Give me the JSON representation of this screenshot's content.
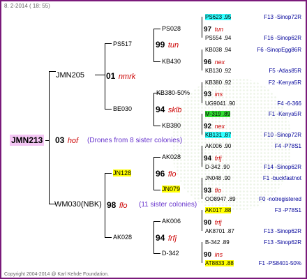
{
  "header": "8.  2-2014 ( 18: 55)",
  "footer": "Copyright 2004-2014 @ Karl Kehde Foundation.",
  "root": {
    "name": "JMN213",
    "gen_num": "03",
    "gen_code": "hof",
    "note": "(Drones from 8 sister colonies)"
  },
  "mid_note": "(11 sister colonies)",
  "nodes": {
    "JMN205": {
      "name": "JMN205"
    },
    "JMN205_g": {
      "num": "01",
      "code": "nmrk"
    },
    "WM030": {
      "name": "WM030(NBK)"
    },
    "WM030_g": {
      "num": "98",
      "code": "flo"
    },
    "PS517": {
      "name": "PS517"
    },
    "PS517_g": {
      "num": "99",
      "code": "tun"
    },
    "BE030": {
      "name": "BE030"
    },
    "BE030_g": {
      "num": "94",
      "code": "sklb"
    },
    "JN128": {
      "name": "JN128"
    },
    "JN128_g": {
      "num": "96",
      "code": "flo"
    },
    "AK028": {
      "name": "AK028"
    },
    "AK028_g": {
      "num": "94",
      "code": "frfj"
    },
    "PS028": {
      "name": "PS028"
    },
    "PS028_g": {
      "num": "97",
      "code": "tun"
    },
    "KB430": {
      "name": "KB430"
    },
    "KB430_g": {
      "num": "96",
      "code": "nex"
    },
    "KB380_50": {
      "name": "KB380-50%"
    },
    "KB380_50_g": {
      "num": "93",
      "code": "ins"
    },
    "KB380": {
      "name": "KB380"
    },
    "KB380_g": {
      "num": "92",
      "code": "nex"
    },
    "AK028b": {
      "name": "AK028"
    },
    "AK028b_g": {
      "num": "94",
      "code": "frfj"
    },
    "JN079": {
      "name": "JN079"
    },
    "JN079_g": {
      "num": "93",
      "code": "flo"
    },
    "AK006": {
      "name": "AK006"
    },
    "AK006_g": {
      "num": "90",
      "code": "frfj"
    },
    "D342": {
      "name": "D-342"
    },
    "D342_g": {
      "num": "90",
      "code": "ins"
    }
  },
  "leaves": [
    {
      "id": "PS623 .95",
      "src": "F13 -Sinop72R",
      "hl": "c"
    },
    {
      "id": "PS554 .94",
      "src": "F16 -Sinop62R",
      "hl": ""
    },
    {
      "id": "KB038 .94",
      "src": "F6 -SinopEgg86R",
      "hl": ""
    },
    {
      "id": "KB130 .92",
      "src": "F5 -Atlas85R",
      "hl": ""
    },
    {
      "id": "KB380 .92",
      "src": "F2 -Kenya5R",
      "hl": ""
    },
    {
      "id": "UG9041 .90",
      "src": "F4 -6-366",
      "hl": ""
    },
    {
      "id": "M-319 .89",
      "src": "F1 -Kenya5R",
      "hl": "g"
    },
    {
      "id": "KB131 .87",
      "src": "F10 -Sinop72R",
      "hl": "c"
    },
    {
      "id": "AK006 .90",
      "src": "F4 -P78S1",
      "hl": ""
    },
    {
      "id": "D-342 .90",
      "src": "F14 -Sinop62R",
      "hl": ""
    },
    {
      "id": "JN048 .90",
      "src": "F1 -buckfastnot",
      "hl": ""
    },
    {
      "id": "OO8947 .89",
      "src": "F0 -notregistered",
      "hl": ""
    },
    {
      "id": "AK017 .88",
      "src": "F3 -P78S1",
      "hl": "y"
    },
    {
      "id": "AK8701 .87",
      "src": "F13 -Sinop62R",
      "hl": ""
    },
    {
      "id": "B-342 .89",
      "src": "F13 -Sinop62R",
      "hl": ""
    },
    {
      "id": "AT8833 .88",
      "src": "F1 -PS8401-50%",
      "hl": "y"
    }
  ],
  "colors": {
    "border": "#7a1a7a",
    "root_bg": "#f4c6f4",
    "gen_code": "#cc0000",
    "source": "#000099",
    "note": "#6633cc",
    "yellow": "#ffff00",
    "cyan": "#33ffff",
    "green": "#33dd33"
  }
}
